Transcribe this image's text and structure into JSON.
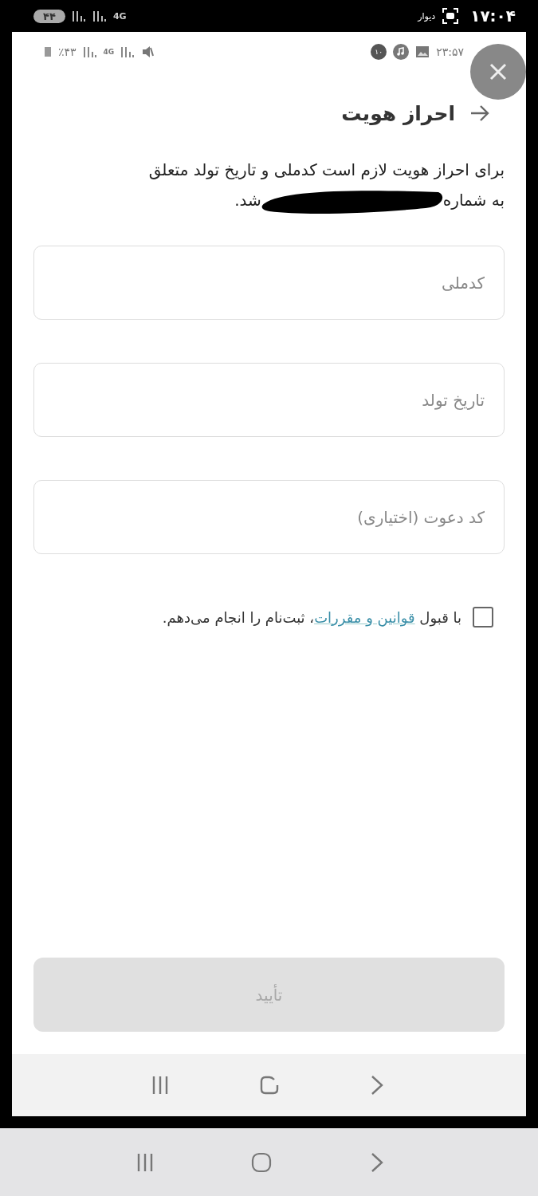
{
  "outer_status_bar": {
    "time": "۱۷:۰۴",
    "app_label": "دیوار",
    "battery_pill": "۴۴",
    "network": "4G"
  },
  "inner_status_bar": {
    "time": "۲۳:۵۷",
    "notification_count": "۱۰",
    "battery": "٪۴۳",
    "network": "4G"
  },
  "header": {
    "title": "احراز هویت"
  },
  "description": {
    "line_1": "برای احراز هویت لازم است کدملی و تاریخ تولد متعلق",
    "line_2_start": "به شماره",
    "line_2_end": "شد.",
    "redacted": true
  },
  "fields": [
    {
      "placeholder": "کدملی"
    },
    {
      "placeholder": "تاریخ تولد"
    },
    {
      "placeholder": "کد دعوت (اختیاری)"
    }
  ],
  "terms": {
    "checked": false,
    "before": "با قبول",
    "link": "قوانین و مقررات",
    "after": "، ثبت‌نام را انجام می‌دهم."
  },
  "confirm_button": {
    "label": "تأیید",
    "disabled": true
  }
}
